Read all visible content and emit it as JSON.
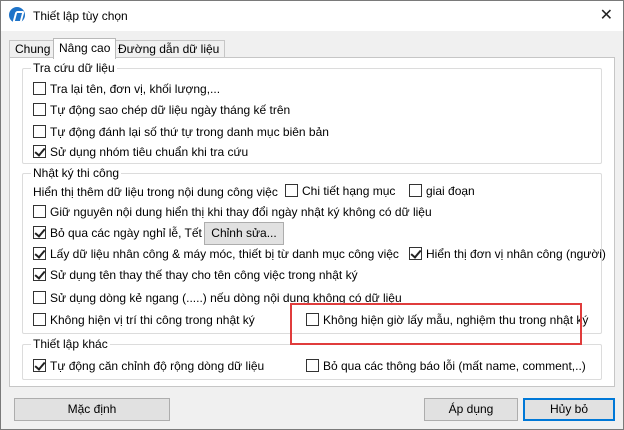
{
  "window": {
    "title": "Thiết lập tùy chọn",
    "close_symbol": "✕"
  },
  "tabs": [
    {
      "label": "Chung"
    },
    {
      "label": "Nâng cao"
    },
    {
      "label": "Đường dẫn dữ liệu"
    }
  ],
  "lookup": {
    "title": "Tra cứu dữ liệu",
    "items": [
      {
        "label": "Tra lại tên, đơn vị, khối lượng,...",
        "checked": false
      },
      {
        "label": "Tự động sao chép dữ liệu ngày tháng kế trên",
        "checked": false
      },
      {
        "label": "Tự động đánh lại số thứ tự trong danh mục biên bản",
        "checked": false
      },
      {
        "label": "Sử dụng nhóm tiêu chuẩn khi tra cứu",
        "checked": true
      }
    ]
  },
  "diary": {
    "title": "Nhật ký thi công",
    "show_extra_label": "Hiển thị thêm dữ liệu trong nội dung công việc",
    "chi_tiet": {
      "label": "Chi tiết hạng mục",
      "checked": false
    },
    "giai_doan": {
      "label": "giai đoạn",
      "checked": false
    },
    "keep_content": {
      "label": "Giữ nguyên nội dung hiển thị khi thay đổi ngày nhật ký không có dữ liệu",
      "checked": false
    },
    "skip_holidays": {
      "label": "Bỏ qua các ngày nghỉ lễ, Tết",
      "checked": true
    },
    "edit_button": "Chỉnh sửa...",
    "get_labor": {
      "label": "Lấy dữ liệu nhân công & máy móc, thiết bị từ danh mục công việc",
      "checked": true
    },
    "show_labor_unit": {
      "label": "Hiển thị đơn vị nhân công (người)",
      "checked": true
    },
    "use_alt_name": {
      "label": "Sử dụng tên thay thế thay cho tên công việc trong nhật ký",
      "checked": true
    },
    "use_dashes": {
      "label": "Sử dụng dòng kẻ ngang (.....) nếu dòng nội dung không có dữ liệu",
      "checked": false
    },
    "hide_position": {
      "label": "Không hiện vị trí thi công trong nhật ký",
      "checked": false
    },
    "hide_sampling": {
      "label": "Không hiện giờ lấy mẫu, nghiệm thu trong nhật ký",
      "checked": false
    }
  },
  "other": {
    "title": "Thiết lập khác",
    "auto_width": {
      "label": "Tự động căn chỉnh độ rộng dòng dữ liệu",
      "checked": true
    },
    "skip_errors": {
      "label": "Bỏ qua các thông báo lỗi (mất name, comment,..)",
      "checked": false
    }
  },
  "buttons": {
    "default": "Mặc định",
    "apply": "Áp dụng",
    "cancel": "Hủy bỏ"
  },
  "highlight_color": "#e03c3c"
}
